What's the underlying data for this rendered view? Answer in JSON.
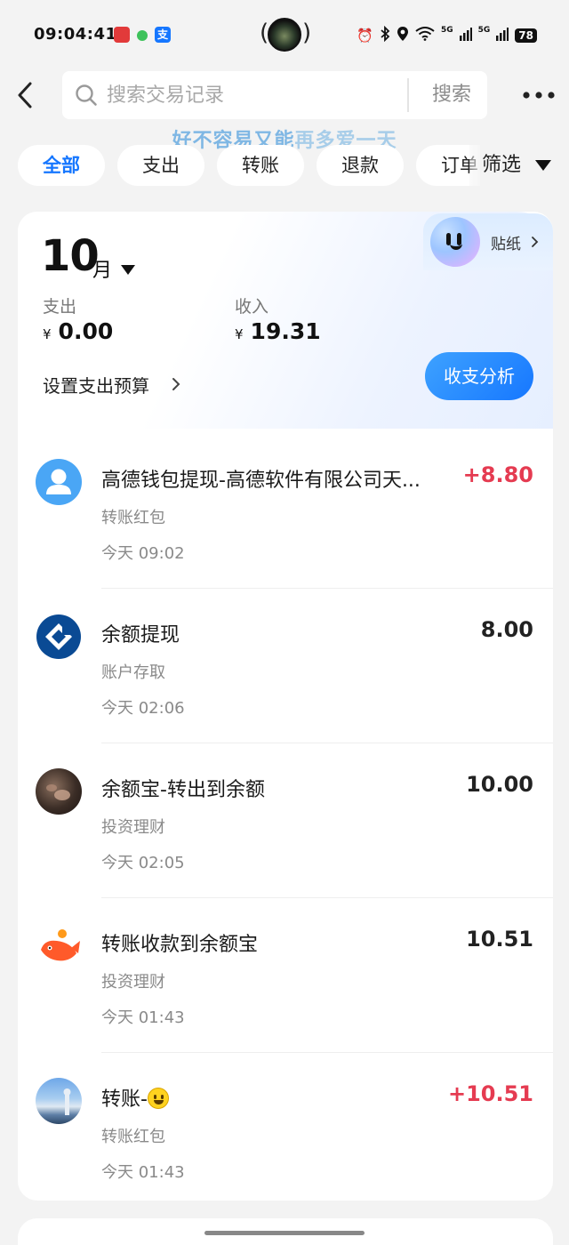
{
  "status_bar": {
    "time": "09:04:41",
    "notif_icons": [
      "app-red-icon",
      "wechat-icon",
      "alipay-icon"
    ],
    "alipay_glyph": "支",
    "net_a": "5G",
    "net_b": "5G",
    "battery": "78"
  },
  "search": {
    "placeholder": "搜索交易记录",
    "button_label": "搜索"
  },
  "watermark": {
    "part_a": "好不容易又能",
    "part_b": "再多爱一天"
  },
  "tabs": [
    {
      "label": "全部",
      "active": true
    },
    {
      "label": "支出",
      "active": false
    },
    {
      "label": "转账",
      "active": false
    },
    {
      "label": "退款",
      "active": false
    },
    {
      "label": "订单",
      "active": false
    }
  ],
  "filter": {
    "label": "筛选"
  },
  "sticker": {
    "label": "贴纸"
  },
  "summary": {
    "month": "10",
    "month_unit": "月",
    "expense_label": "支出",
    "expense_currency": "¥",
    "expense_value": "0.00",
    "income_label": "收入",
    "income_currency": "¥",
    "income_value": "19.31",
    "budget_label": "设置支出预算",
    "analysis_label": "收支分析"
  },
  "transactions": [
    {
      "title": "高德钱包提现-高德软件有限公司天...",
      "category": "转账红包",
      "time": "今天 09:02",
      "amount": "+8.80",
      "positive": true,
      "icon": "person-avatar-icon"
    },
    {
      "title": "余额提现",
      "category": "账户存取",
      "time": "今天 02:06",
      "amount": "8.00",
      "positive": false,
      "icon": "ccb-bank-icon"
    },
    {
      "title": "余额宝-转出到余额",
      "category": "投资理财",
      "time": "今天 02:05",
      "amount": "10.00",
      "positive": false,
      "icon": "user-photo-avatar"
    },
    {
      "title": "转账收款到余额宝",
      "category": "投资理财",
      "time": "今天 01:43",
      "amount": "10.51",
      "positive": false,
      "icon": "yuebao-fish-icon"
    },
    {
      "title": "转账-",
      "category": "转账红包",
      "time": "今天 01:43",
      "amount": "+10.51",
      "positive": true,
      "icon": "sky-photo-avatar",
      "emoji": "grinning-face-emoji"
    }
  ],
  "colors": {
    "accent": "#1677ff",
    "positive_amount": "#e53b51",
    "background": "#f3f3f3"
  }
}
